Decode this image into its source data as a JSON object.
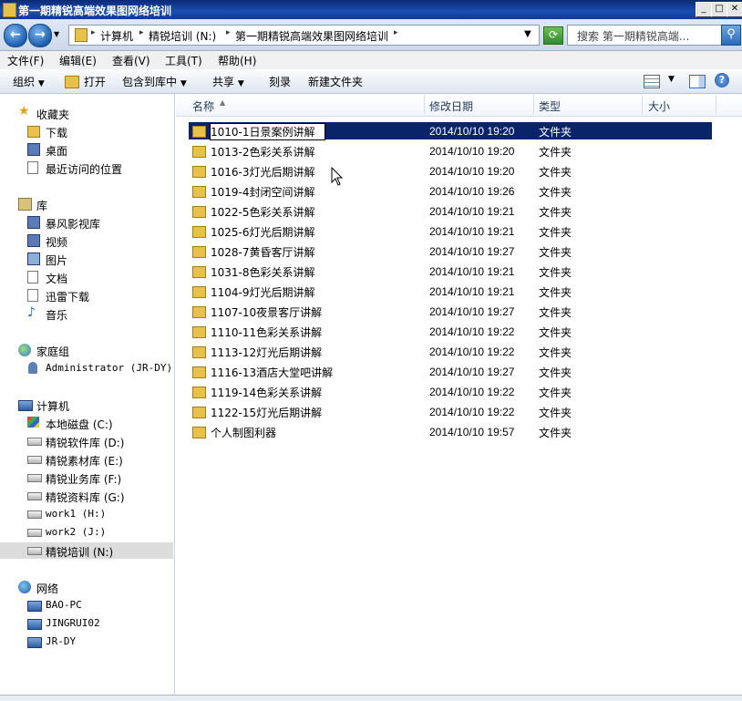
{
  "window": {
    "title": "第一期精锐高端效果图网络培训"
  },
  "address": {
    "crumbs": [
      "计算机",
      "精锐培训 (N:)",
      "第一期精锐高端效果图网络培训"
    ],
    "search_placeholder": "搜索 第一期精锐高端..."
  },
  "menu": [
    "文件(F)",
    "编辑(E)",
    "查看(V)",
    "工具(T)",
    "帮助(H)"
  ],
  "toolbar": {
    "organize": "组织",
    "open": "打开",
    "include_library": "包含到库中",
    "share": "共享",
    "burn": "刻录",
    "new_folder": "新建文件夹"
  },
  "sidebar": {
    "favorites": {
      "title": "收藏夹",
      "items": [
        "下载",
        "桌面",
        "最近访问的位置"
      ]
    },
    "libraries": {
      "title": "库",
      "items": [
        "暴风影视库",
        "视频",
        "图片",
        "文档",
        "迅雷下载",
        "音乐"
      ]
    },
    "homegroup": {
      "title": "家庭组",
      "items": [
        "Administrator (JR-DY)"
      ]
    },
    "computer": {
      "title": "计算机",
      "items": [
        "本地磁盘 (C:)",
        "精锐软件库 (D:)",
        "精锐素材库 (E:)",
        "精锐业务库 (F:)",
        "精锐资料库 (G:)",
        "work1 (H:)",
        "work2 (J:)",
        "精锐培训 (N:)"
      ]
    },
    "network": {
      "title": "网络",
      "items": [
        "BAO-PC",
        "JINGRUI02",
        "JR-DY"
      ]
    }
  },
  "columns": {
    "name": "名称",
    "modified": "修改日期",
    "type": "类型",
    "size": "大小"
  },
  "files": [
    {
      "name": "1010-1日景案例讲解",
      "date": "2014/10/10 19:20",
      "type": "文件夹",
      "selected": true
    },
    {
      "name": "1013-2色彩关系讲解",
      "date": "2014/10/10 19:20",
      "type": "文件夹"
    },
    {
      "name": "1016-3灯光后期讲解",
      "date": "2014/10/10 19:20",
      "type": "文件夹"
    },
    {
      "name": "1019-4封闭空间讲解",
      "date": "2014/10/10 19:26",
      "type": "文件夹"
    },
    {
      "name": "1022-5色彩关系讲解",
      "date": "2014/10/10 19:21",
      "type": "文件夹"
    },
    {
      "name": "1025-6灯光后期讲解",
      "date": "2014/10/10 19:21",
      "type": "文件夹"
    },
    {
      "name": "1028-7黄昏客厅讲解",
      "date": "2014/10/10 19:27",
      "type": "文件夹"
    },
    {
      "name": "1031-8色彩关系讲解",
      "date": "2014/10/10 19:21",
      "type": "文件夹"
    },
    {
      "name": "1104-9灯光后期讲解",
      "date": "2014/10/10 19:21",
      "type": "文件夹"
    },
    {
      "name": "1107-10夜景客厅讲解",
      "date": "2014/10/10 19:27",
      "type": "文件夹"
    },
    {
      "name": "1110-11色彩关系讲解",
      "date": "2014/10/10 19:22",
      "type": "文件夹"
    },
    {
      "name": "1113-12灯光后期讲解",
      "date": "2014/10/10 19:22",
      "type": "文件夹"
    },
    {
      "name": "1116-13酒店大堂吧讲解",
      "date": "2014/10/10 19:27",
      "type": "文件夹"
    },
    {
      "name": "1119-14色彩关系讲解",
      "date": "2014/10/10 19:22",
      "type": "文件夹"
    },
    {
      "name": "1122-15灯光后期讲解",
      "date": "2014/10/10 19:22",
      "type": "文件夹"
    },
    {
      "name": "个人制图利器",
      "date": "2014/10/10 19:57",
      "type": "文件夹"
    }
  ]
}
